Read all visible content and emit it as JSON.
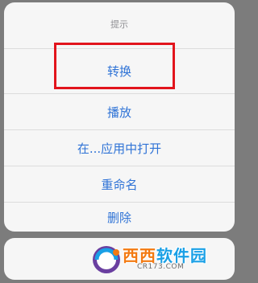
{
  "action_sheet": {
    "title": "提示",
    "items": [
      {
        "label": "转换",
        "highlighted": true
      },
      {
        "label": "播放"
      },
      {
        "label": "在...应用中打开"
      },
      {
        "label": "重命名"
      },
      {
        "label": "删除"
      }
    ],
    "cancel_label": ""
  },
  "highlight": {
    "color": "#e2141c",
    "target": "转换"
  },
  "colors": {
    "action_text": "#2f73d6",
    "sheet_bg": "#f6f6f6",
    "overlay": "#7c7c7c"
  },
  "watermark": {
    "brand_part1": "西西",
    "brand_part2": "软件园",
    "url": "CR173.COM"
  }
}
